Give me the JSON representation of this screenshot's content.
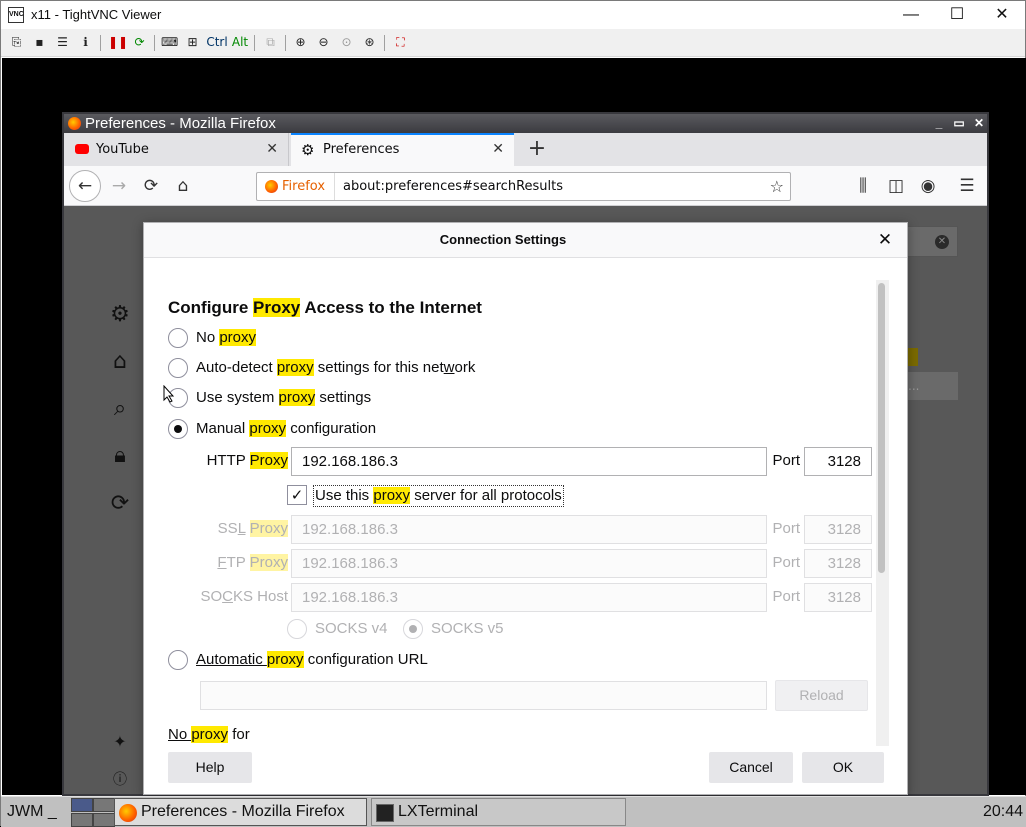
{
  "vnc": {
    "title": "x11 - TightVNC Viewer",
    "icon_text": "VNC",
    "minimize": "—",
    "maximize": "☐",
    "close": "✕",
    "toolbar": {
      "ctrl": "Ctrl",
      "alt": "Alt"
    }
  },
  "firefox": {
    "title": "Preferences - Mozilla Firefox",
    "controls": {
      "min": "_",
      "max": "▭",
      "close": "✕"
    },
    "tabs": [
      {
        "label": "YouTube",
        "close": "✕"
      },
      {
        "label": "Preferences",
        "close": "✕"
      }
    ],
    "newtab": "+",
    "identity": "Firefox",
    "url": "about:preferences#searchResults",
    "bg_button": "..."
  },
  "dialog": {
    "title": "Connection Settings",
    "close": "✕",
    "heading_pre": "Configure ",
    "heading_hl": "Proxy",
    "heading_post": " Access to the Internet",
    "options": [
      {
        "pre": "No ",
        "hl": "proxy",
        "post": "",
        "selected": false
      },
      {
        "pre": "Auto-detect ",
        "hl": "proxy",
        "post": " settings for this net",
        "u": "w",
        "post2": "ork",
        "selected": false
      },
      {
        "pre": "Use system ",
        "hl": "proxy",
        "post": " settings",
        "selected": false
      },
      {
        "pre": "Manual ",
        "hl": "proxy",
        "post": " configuration",
        "selected": true
      }
    ],
    "http": {
      "label": "HTTP ",
      "label_hl": "Proxy",
      "value": "192.168.186.3",
      "port_label": "Port",
      "port": "3128"
    },
    "use_all": {
      "pre": "Use this ",
      "hl": "proxy",
      "post": " server for all protocols",
      "checked": true,
      "check": "✓"
    },
    "ssl": {
      "label_pre": "SS",
      "label_u": "L",
      "label_post": " ",
      "label_hl": "Proxy",
      "value": "192.168.186.3",
      "port_label": "Port",
      "port": "3128"
    },
    "ftp": {
      "label_u": "F",
      "label_post": "TP ",
      "label_hl": "Proxy",
      "value": "192.168.186.3",
      "port_label": "Port",
      "port": "3128"
    },
    "socks": {
      "label_pre": "SO",
      "label_u": "C",
      "label_post": "KS Host",
      "value": "192.168.186.3",
      "port_label": "Port",
      "port": "3128"
    },
    "socks_v4": "SOCKS v4",
    "socks_v5": "SOCKS v5",
    "auto_url": {
      "pre": "Automatic ",
      "hl": "proxy",
      "post": " configuration URL",
      "selected": false,
      "value": ""
    },
    "reload": "Reload",
    "no_proxy": {
      "pre": "No ",
      "hl": "proxy",
      "post": " for"
    },
    "help": "Help",
    "cancel": "Cancel",
    "ok": "OK"
  },
  "taskbar": {
    "start": "JWM _",
    "tasks": [
      "Preferences - Mozilla Firefox",
      "LXTerminal"
    ],
    "clock": "20:44"
  }
}
